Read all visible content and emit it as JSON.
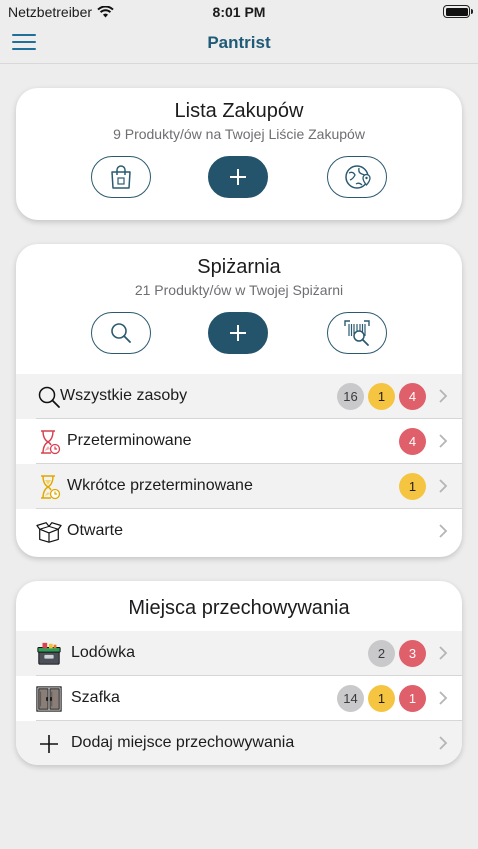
{
  "status_bar": {
    "carrier": "Netzbetreiber",
    "time": "8:01 PM"
  },
  "nav": {
    "title": "Pantrist",
    "menu_icon": "hamburger-menu-icon"
  },
  "shopping": {
    "title": "Lista Zakupów",
    "subtitle": "9 Produkty/ów na Twojej Liście Zakupów",
    "buttons": [
      {
        "icon": "shopping-bag-icon"
      },
      {
        "icon": "plus-icon"
      },
      {
        "icon": "store-map-icon"
      }
    ]
  },
  "pantry": {
    "title": "Spiżarnia",
    "subtitle": "21 Produkty/ów w Twojej Spiżarni",
    "buttons": [
      {
        "icon": "search-icon"
      },
      {
        "icon": "plus-icon"
      },
      {
        "icon": "barcode-scan-icon"
      }
    ],
    "rows": [
      {
        "label": "Wszystkie zasoby",
        "icon": "search-icon",
        "badges": [
          "16",
          "1",
          "4"
        ]
      },
      {
        "label": "Przeterminowane",
        "icon": "hourglass-expired-icon",
        "badges": [
          "4"
        ]
      },
      {
        "label": "Wkrótce przeterminowane",
        "icon": "hourglass-soon-icon",
        "badges": [
          "1"
        ]
      },
      {
        "label": "Otwarte",
        "icon": "open-box-icon",
        "badges": []
      }
    ]
  },
  "storage": {
    "title": "Miejsca przechowywania",
    "rows": [
      {
        "label": "Lodówka",
        "icon": "cooler-icon",
        "badges": [
          "2",
          "3"
        ]
      },
      {
        "label": "Szafka",
        "icon": "cupboard-icon",
        "badges": [
          "14",
          "1",
          "1"
        ]
      },
      {
        "label": "Dodaj miejsce przechowywania",
        "icon": "plus-icon",
        "badges": []
      }
    ]
  },
  "colors": {
    "accent": "#24546b",
    "nav_title": "#1f5a77",
    "badge_gray": "#c9c9cc",
    "badge_yellow": "#f5c542",
    "badge_red": "#df5f6a",
    "background": "#ededed"
  }
}
